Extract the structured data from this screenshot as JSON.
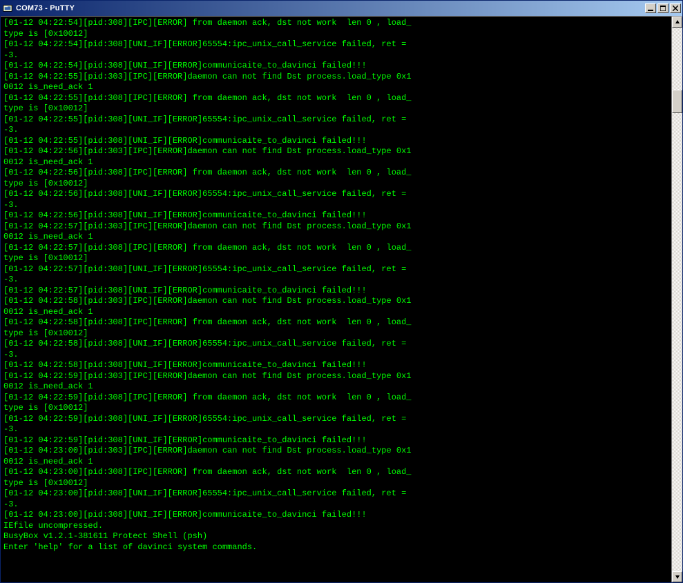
{
  "window": {
    "title": "COM73 - PuTTY"
  },
  "terminal": {
    "lines": [
      "[01-12 04:22:54][pid:308][IPC][ERROR] from daemon ack, dst not work  len 0 , load_",
      "type is [0x10012]",
      "[01-12 04:22:54][pid:308][UNI_IF][ERROR]65554:ipc_unix_call_service failed, ret =",
      "-3.",
      "[01-12 04:22:54][pid:308][UNI_IF][ERROR]communicaite_to_davinci failed!!!",
      "[01-12 04:22:55][pid:303][IPC][ERROR]daemon can not find Dst process.load_type 0x1",
      "0012 is_need_ack 1",
      "[01-12 04:22:55][pid:308][IPC][ERROR] from daemon ack, dst not work  len 0 , load_",
      "type is [0x10012]",
      "[01-12 04:22:55][pid:308][UNI_IF][ERROR]65554:ipc_unix_call_service failed, ret =",
      "-3.",
      "[01-12 04:22:55][pid:308][UNI_IF][ERROR]communicaite_to_davinci failed!!!",
      "[01-12 04:22:56][pid:303][IPC][ERROR]daemon can not find Dst process.load_type 0x1",
      "0012 is_need_ack 1",
      "[01-12 04:22:56][pid:308][IPC][ERROR] from daemon ack, dst not work  len 0 , load_",
      "type is [0x10012]",
      "[01-12 04:22:56][pid:308][UNI_IF][ERROR]65554:ipc_unix_call_service failed, ret =",
      "-3.",
      "[01-12 04:22:56][pid:308][UNI_IF][ERROR]communicaite_to_davinci failed!!!",
      "[01-12 04:22:57][pid:303][IPC][ERROR]daemon can not find Dst process.load_type 0x1",
      "0012 is_need_ack 1",
      "[01-12 04:22:57][pid:308][IPC][ERROR] from daemon ack, dst not work  len 0 , load_",
      "type is [0x10012]",
      "[01-12 04:22:57][pid:308][UNI_IF][ERROR]65554:ipc_unix_call_service failed, ret =",
      "-3.",
      "[01-12 04:22:57][pid:308][UNI_IF][ERROR]communicaite_to_davinci failed!!!",
      "[01-12 04:22:58][pid:303][IPC][ERROR]daemon can not find Dst process.load_type 0x1",
      "0012 is_need_ack 1",
      "[01-12 04:22:58][pid:308][IPC][ERROR] from daemon ack, dst not work  len 0 , load_",
      "type is [0x10012]",
      "[01-12 04:22:58][pid:308][UNI_IF][ERROR]65554:ipc_unix_call_service failed, ret =",
      "-3.",
      "[01-12 04:22:58][pid:308][UNI_IF][ERROR]communicaite_to_davinci failed!!!",
      "[01-12 04:22:59][pid:303][IPC][ERROR]daemon can not find Dst process.load_type 0x1",
      "0012 is_need_ack 1",
      "[01-12 04:22:59][pid:308][IPC][ERROR] from daemon ack, dst not work  len 0 , load_",
      "type is [0x10012]",
      "[01-12 04:22:59][pid:308][UNI_IF][ERROR]65554:ipc_unix_call_service failed, ret =",
      "-3.",
      "[01-12 04:22:59][pid:308][UNI_IF][ERROR]communicaite_to_davinci failed!!!",
      "[01-12 04:23:00][pid:303][IPC][ERROR]daemon can not find Dst process.load_type 0x1",
      "0012 is_need_ack 1",
      "[01-12 04:23:00][pid:308][IPC][ERROR] from daemon ack, dst not work  len 0 , load_",
      "type is [0x10012]",
      "[01-12 04:23:00][pid:308][UNI_IF][ERROR]65554:ipc_unix_call_service failed, ret =",
      "-3.",
      "[01-12 04:23:00][pid:308][UNI_IF][ERROR]communicaite_to_davinci failed!!!",
      "IEfile uncompressed.",
      "BusyBox v1.2.1-381611 Protect Shell (psh)",
      "Enter 'help' for a list of davinci system commands.",
      ""
    ]
  }
}
